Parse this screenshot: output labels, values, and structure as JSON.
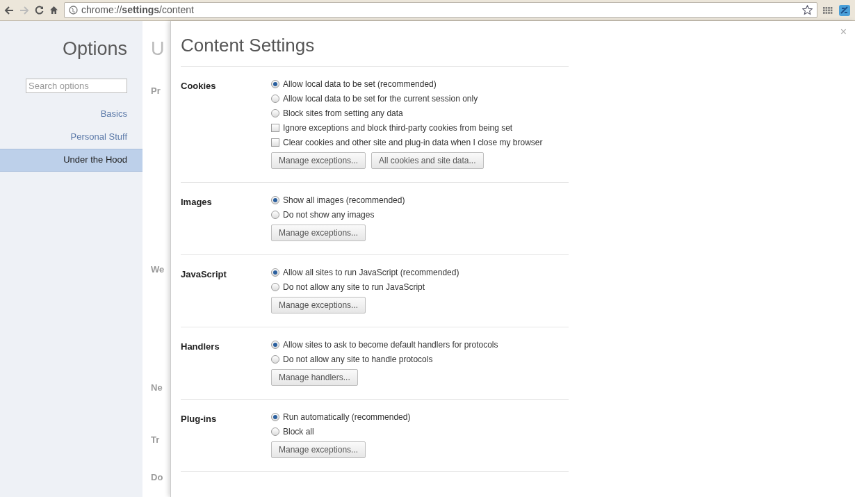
{
  "toolbar": {
    "address": "chrome://**settings**/content"
  },
  "sidebar": {
    "title": "Options",
    "search": {
      "placeholder": "Search options"
    },
    "items": [
      {
        "label": "Basics",
        "selected": false
      },
      {
        "label": "Personal Stuff",
        "selected": false
      },
      {
        "label": "Under the Hood",
        "selected": true
      }
    ]
  },
  "background_page": {
    "title": "U",
    "sections": [
      {
        "label": "Pr"
      },
      {
        "label": "We"
      },
      {
        "label": "Ne"
      },
      {
        "label": "Tr"
      },
      {
        "label": "Do"
      }
    ]
  },
  "dialog": {
    "title": "Content Settings",
    "close": "×",
    "sections": [
      {
        "label": "Cookies",
        "options": [
          {
            "kind": "radio",
            "label": "Allow local data to be set (recommended)",
            "selected": true
          },
          {
            "kind": "radio",
            "label": "Allow local data to be set for the current session only",
            "selected": false
          },
          {
            "kind": "radio",
            "label": "Block sites from setting any data",
            "selected": false
          },
          {
            "kind": "checkbox",
            "label": "Ignore exceptions and block third-party cookies from being set",
            "checked": false
          },
          {
            "kind": "checkbox",
            "label": "Clear cookies and other site and plug-in data when I close my browser",
            "checked": false
          }
        ],
        "buttons": [
          "Manage exceptions...",
          "All cookies and site data..."
        ]
      },
      {
        "label": "Images",
        "options": [
          {
            "kind": "radio",
            "label": "Show all images (recommended)",
            "selected": true
          },
          {
            "kind": "radio",
            "label": "Do not show any images",
            "selected": false
          }
        ],
        "buttons": [
          "Manage exceptions..."
        ]
      },
      {
        "label": "JavaScript",
        "options": [
          {
            "kind": "radio",
            "label": "Allow all sites to run JavaScript (recommended)",
            "selected": true
          },
          {
            "kind": "radio",
            "label": "Do not allow any site to run JavaScript",
            "selected": false
          }
        ],
        "buttons": [
          "Manage exceptions..."
        ]
      },
      {
        "label": "Handlers",
        "options": [
          {
            "kind": "radio",
            "label": "Allow sites to ask to become default handlers for protocols",
            "selected": true
          },
          {
            "kind": "radio",
            "label": "Do not allow any site to handle protocols",
            "selected": false
          }
        ],
        "buttons": [
          "Manage handlers..."
        ]
      },
      {
        "label": "Plug-ins",
        "options": [
          {
            "kind": "radio",
            "label": "Run automatically (recommended)",
            "selected": true
          },
          {
            "kind": "radio",
            "label": "Block all",
            "selected": false
          }
        ],
        "buttons": [
          "Manage exceptions..."
        ]
      }
    ]
  }
}
